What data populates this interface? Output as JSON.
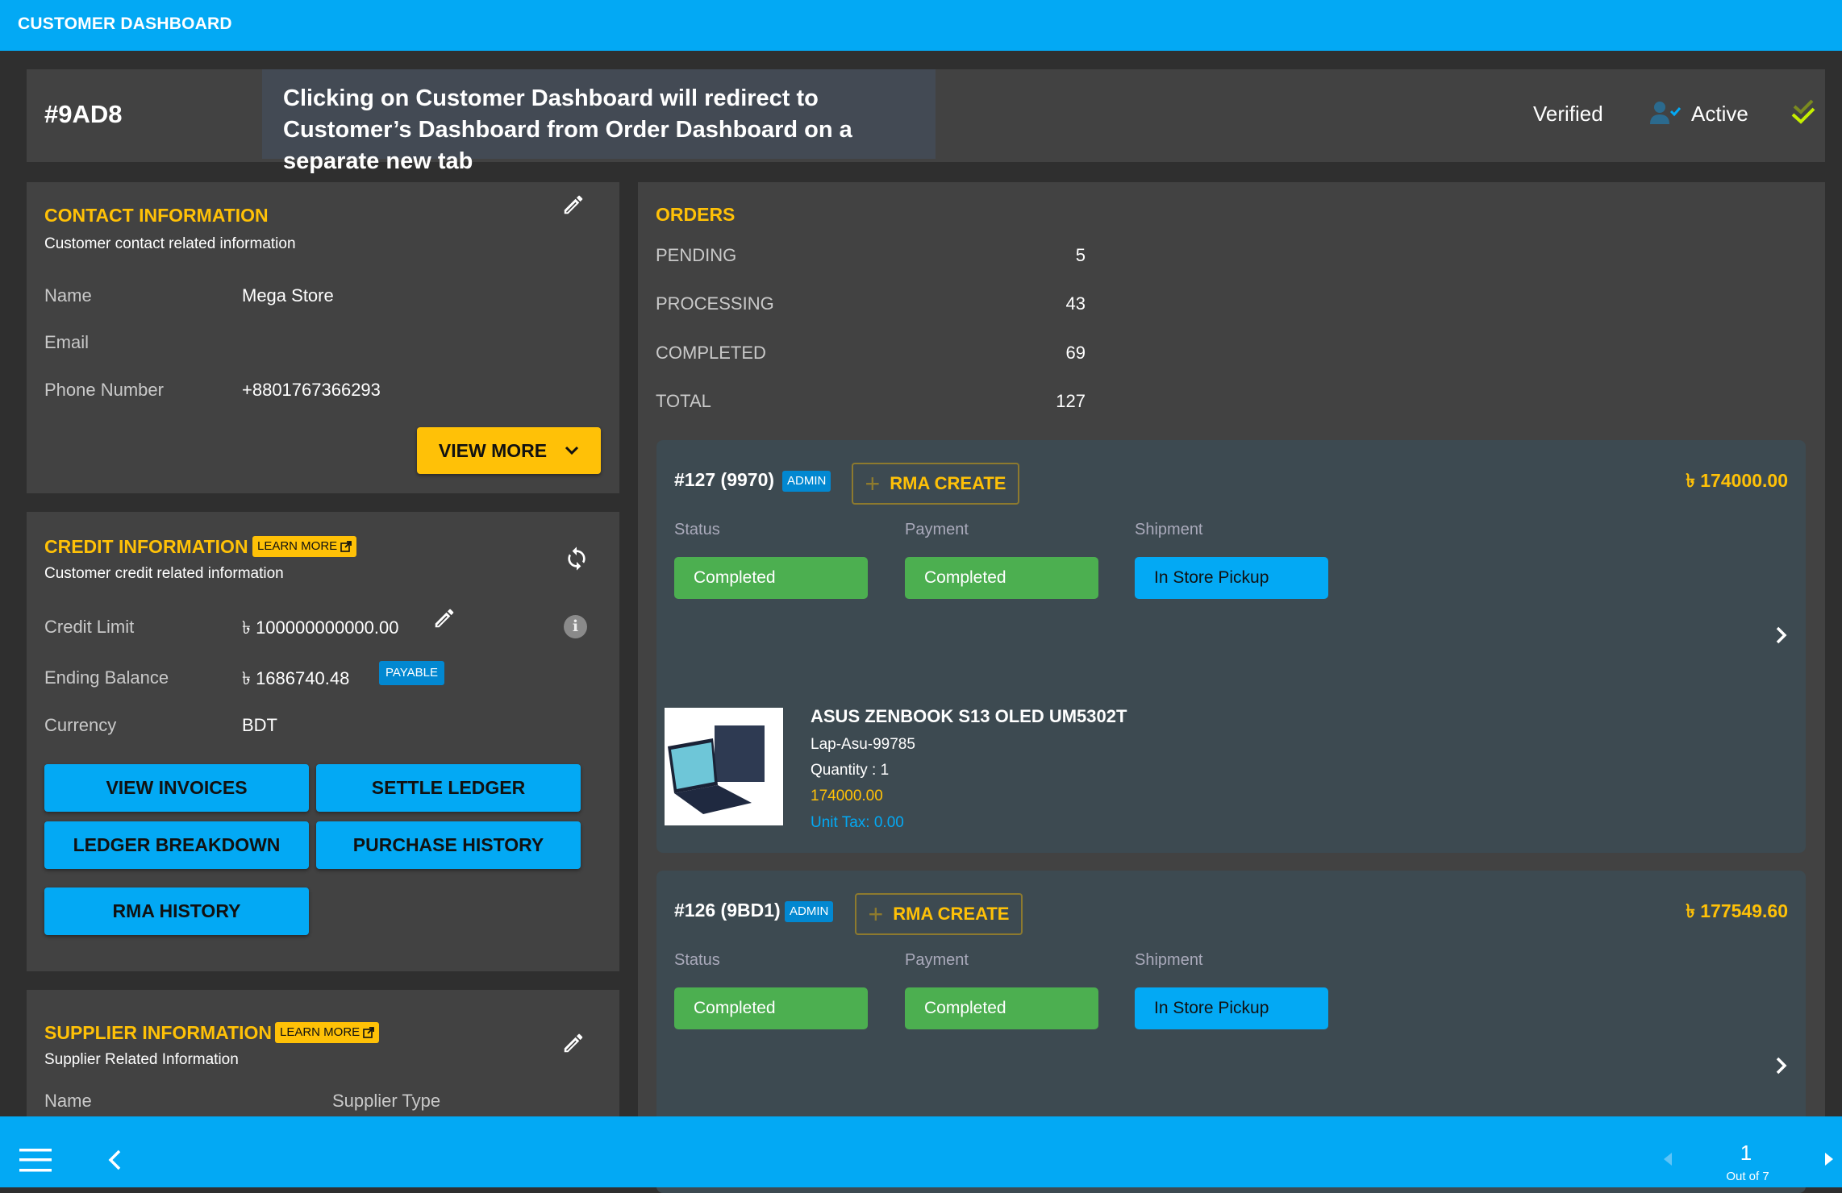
{
  "topbar": {
    "title": "CUSTOMER DASHBOARD"
  },
  "header": {
    "order_id": "#9AD8",
    "verified_label": "Verified",
    "verified_icon": "user-check-icon",
    "active_label": "Active",
    "active_icon": "double-check-icon"
  },
  "tooltip": {
    "text": "Clicking on Customer Dashboard will redirect to Customer’s Dashboard from Order Dashboard on a separate new tab"
  },
  "contact": {
    "title": "CONTACT INFORMATION",
    "subtitle": "Customer contact related information",
    "rows": [
      {
        "label": "Name",
        "value": "Mega Store"
      },
      {
        "label": "Email",
        "value": ""
      },
      {
        "label": "Phone Number",
        "value": "+8801767366293"
      }
    ],
    "view_more_label": "VIEW MORE",
    "edit_icon": "pencil-icon"
  },
  "credit": {
    "title": "CREDIT INFORMATION",
    "learn_more_label": "LEARN MORE",
    "subtitle": "Customer credit related information",
    "rows": [
      {
        "label": "Credit Limit",
        "value": "৳ 100000000000.00"
      },
      {
        "label": "Ending Balance",
        "value": "৳ 1686740.48"
      },
      {
        "label": "Currency",
        "value": "BDT"
      }
    ],
    "balance_badge": "PAYABLE",
    "info_glyph": "i",
    "buttons": {
      "view_invoices": "VIEW INVOICES",
      "settle_ledger": "SETTLE LEDGER",
      "ledger_breakdown": "LEDGER BREAKDOWN",
      "purchase_history": "PURCHASE HISTORY",
      "rma_history": "RMA HISTORY"
    }
  },
  "supplier": {
    "title": "SUPPLIER INFORMATION",
    "learn_more_label": "LEARN MORE",
    "subtitle": "Supplier Related Information",
    "col_name": "Name",
    "col_type": "Supplier Type"
  },
  "orders": {
    "title": "ORDERS",
    "stats": [
      {
        "label": "PENDING",
        "value": "5"
      },
      {
        "label": "PROCESSING",
        "value": "43"
      },
      {
        "label": "COMPLETED",
        "value": "69"
      },
      {
        "label": "TOTAL",
        "value": "127"
      }
    ],
    "labels": {
      "status": "Status",
      "payment": "Payment",
      "shipment": "Shipment"
    },
    "list": [
      {
        "id": "#127 (9970)",
        "badge": "ADMIN",
        "rma_label": "RMA CREATE",
        "amount": "৳ 174000.00",
        "status": "Completed",
        "payment": "Completed",
        "shipment": "In Store Pickup",
        "product": {
          "name": "ASUS ZENBOOK S13 OLED UM5302T",
          "sku": "Lap-Asu-99785",
          "quantity": "Quantity : 1",
          "price": "174000.00",
          "tax": "Unit Tax: 0.00"
        }
      },
      {
        "id": "#126 (9BD1)",
        "badge": "ADMIN",
        "rma_label": "RMA CREATE",
        "amount": "৳ 177549.60",
        "status": "Completed",
        "payment": "Completed",
        "shipment": "In Store Pickup"
      }
    ]
  },
  "pagination": {
    "current": "1",
    "out_of": "Out of 7"
  },
  "colors": {
    "primary": "#03a9f4",
    "accent": "#ffc107",
    "success": "#4caf50",
    "badge_blue": "#0288d1",
    "card_bg": "#424242",
    "order_card_bg": "#3d4a51",
    "page_bg": "#2f2f2f"
  }
}
